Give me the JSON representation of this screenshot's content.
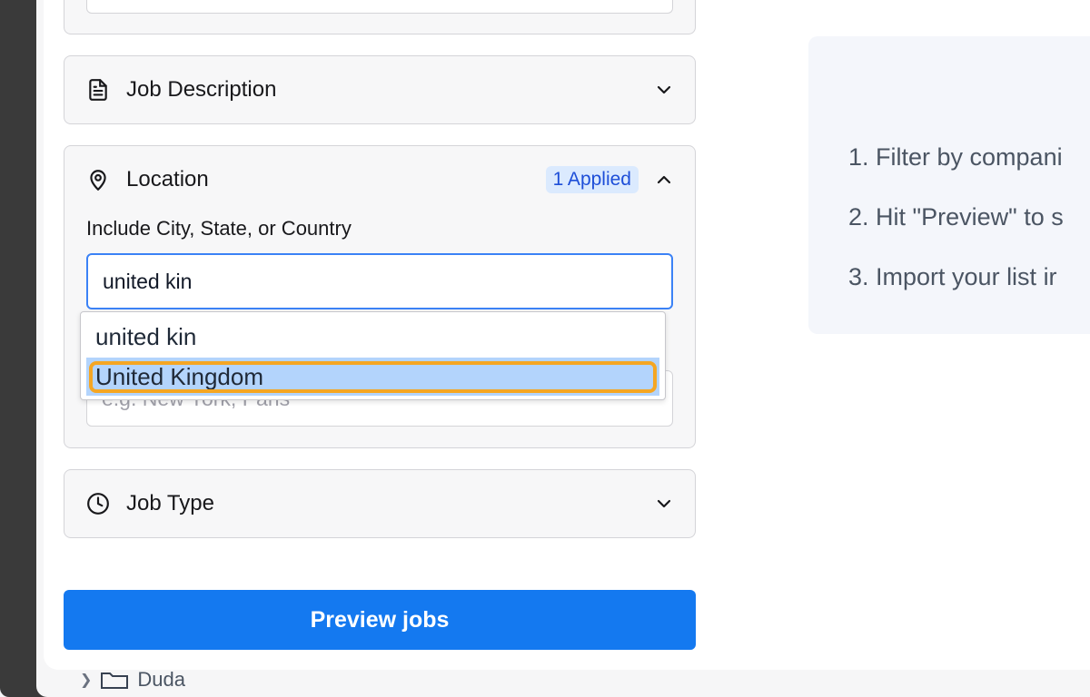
{
  "sections": {
    "job_description": {
      "title": "Job Description"
    },
    "location": {
      "title": "Location",
      "badge": "1 Applied",
      "include_label": "Include City, State, or Country",
      "include_value": "united kin",
      "exclude_placeholder": "e.g. New York, Paris"
    },
    "job_type": {
      "title": "Job Type"
    }
  },
  "dropdown": {
    "items": [
      "united kin",
      "United Kingdom"
    ],
    "selected_index": 1
  },
  "preview_button": {
    "label": "Preview jobs"
  },
  "instructions": [
    "1. Filter by compani",
    "2. Hit \"Preview\" to s",
    "3. Import your list ir"
  ],
  "background_tree": {
    "folder_name": "Duda"
  },
  "colors": {
    "accent": "#1479f0",
    "badge_bg": "#dbeafe",
    "badge_text": "#1d4ed8",
    "highlight_ring": "#f5a623",
    "selected_option": "#b3d4fc"
  },
  "icons": {
    "job_description": "document-icon",
    "location": "map-pin-icon",
    "job_type": "clock-icon",
    "collapse": "chevron-up-icon",
    "expand": "chevron-down-icon",
    "folder": "folder-icon"
  }
}
